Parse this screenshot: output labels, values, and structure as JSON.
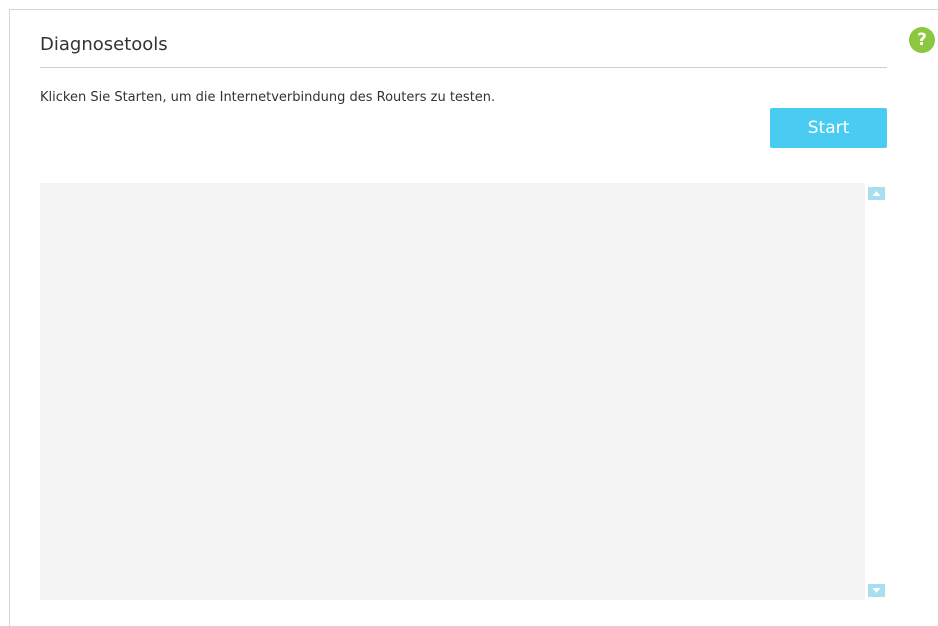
{
  "section": {
    "title": "Diagnosetools",
    "description": "Klicken Sie Starten, um die Internetverbindung des Routers zu testen.",
    "start_label": "Start",
    "help_icon": "?"
  },
  "output": {
    "content": ""
  },
  "colors": {
    "button": "#4acbf2",
    "help": "#8dc63f",
    "output_bg": "#f4f4f4",
    "scroll_arrow": "#a8def1"
  },
  "icons": {
    "help": "help-icon",
    "scroll_up": "scroll-up-arrow-icon",
    "scroll_down": "scroll-down-arrow-icon"
  }
}
